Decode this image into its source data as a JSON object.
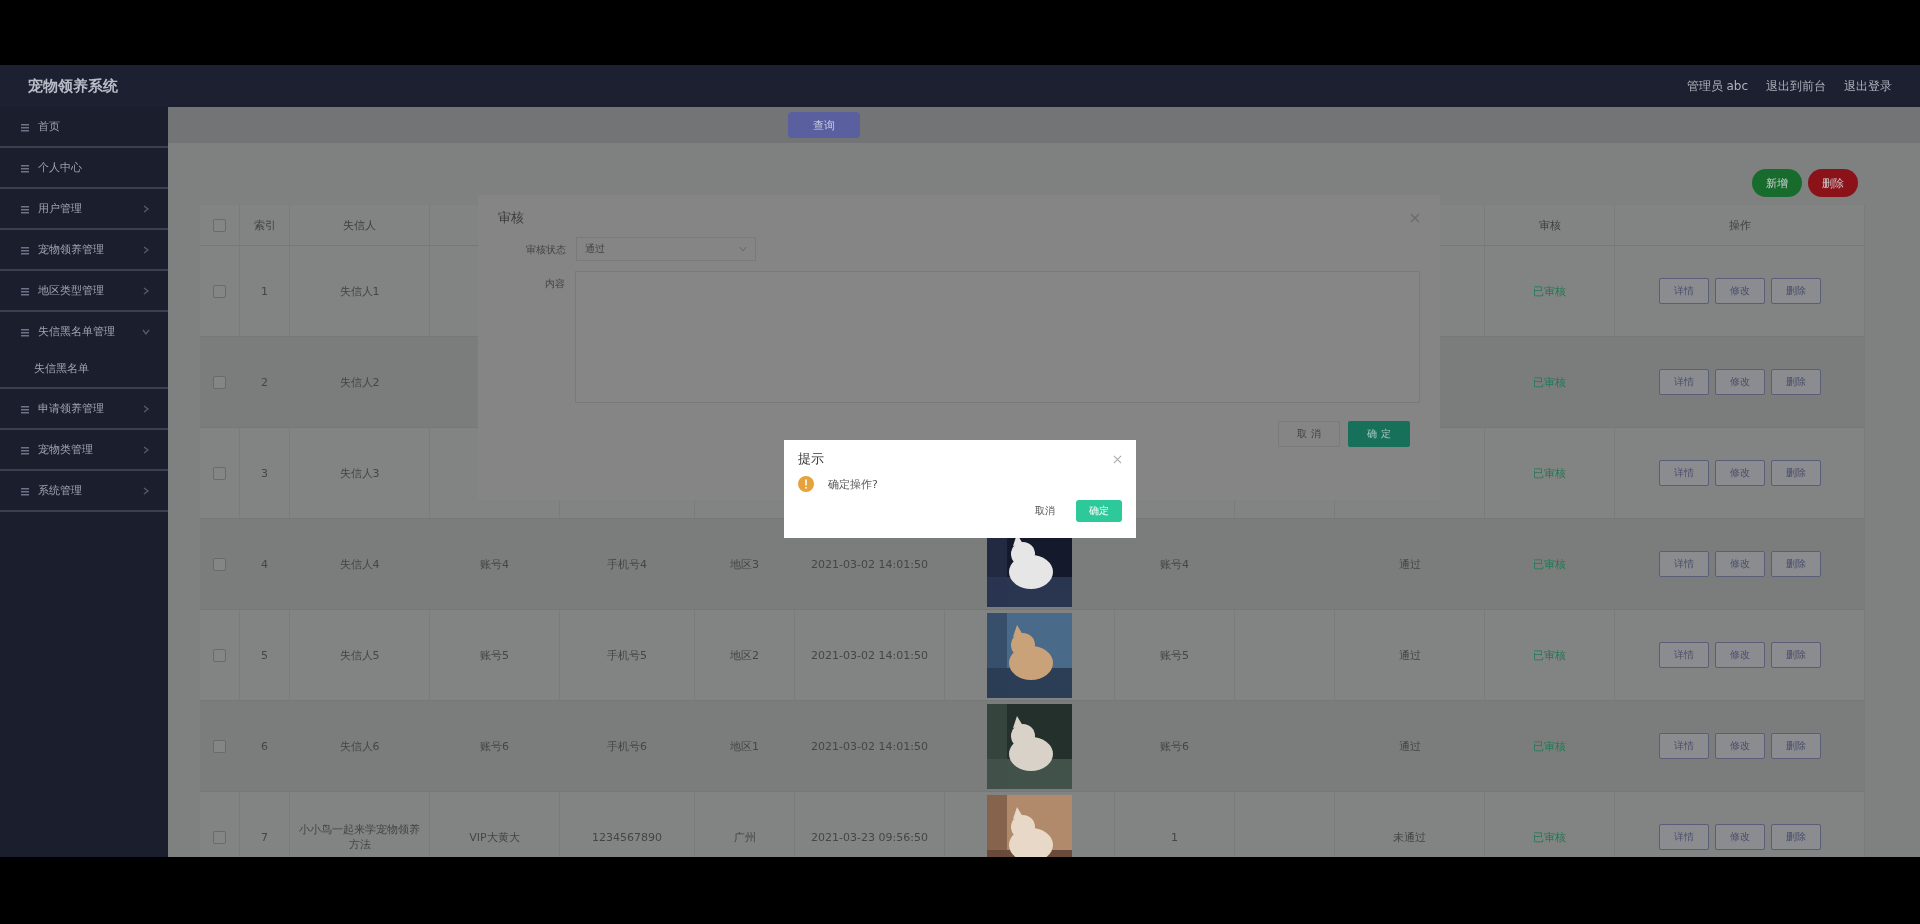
{
  "app": {
    "title": "宠物领养系统"
  },
  "header": {
    "user": "管理员 abc",
    "links": [
      "退出到前台",
      "退出登录"
    ]
  },
  "sidebar": {
    "items": [
      {
        "label": "首页",
        "kind": "plain"
      },
      {
        "label": "个人中心",
        "kind": "plain"
      },
      {
        "label": "用户管理",
        "kind": "menu",
        "expanded": false
      },
      {
        "label": "宠物领养管理",
        "kind": "menu",
        "expanded": false
      },
      {
        "label": "地区类型管理",
        "kind": "menu",
        "expanded": false
      },
      {
        "label": "失信黑名单管理",
        "kind": "menu",
        "expanded": true,
        "children": [
          {
            "label": "失信黑名单"
          }
        ]
      },
      {
        "label": "申请领养管理",
        "kind": "menu",
        "expanded": false
      },
      {
        "label": "宠物类管理",
        "kind": "menu",
        "expanded": false
      },
      {
        "label": "系统管理",
        "kind": "menu",
        "expanded": false
      }
    ]
  },
  "toolbar": {
    "search_button": "查询",
    "action_buttons": [
      {
        "label": "新增",
        "kind": "add"
      },
      {
        "label": "删除",
        "kind": "delete"
      }
    ]
  },
  "table": {
    "all_checked": false,
    "columns": [
      "索引",
      "失信人",
      "审核",
      "操作"
    ],
    "rows": [
      {
        "checked": false,
        "index": "1",
        "name": "失信人1",
        "status": "已审核",
        "actions": [
          "详情",
          "修改",
          "删除"
        ]
      },
      {
        "checked": false,
        "index": "2",
        "name": "失信人2",
        "status": "已审核",
        "actions": [
          "详情",
          "修改",
          "删除"
        ]
      },
      {
        "checked": false,
        "index": "3",
        "name": "失信人3",
        "status": "已审核",
        "actions": [
          "详情",
          "修改",
          "删除"
        ]
      },
      {
        "checked": false,
        "index": "4",
        "name": "失信人4",
        "field_3": "账号4",
        "field_4": "手机号4",
        "field_5": "地区3",
        "date": "2021-03-02 14:01:50",
        "photo": {
          "kind": "picture"
        },
        "field_7": "账号4",
        "review": "通过",
        "status": "已审核",
        "actions": [
          "详情",
          "修改",
          "删除"
        ]
      },
      {
        "checked": false,
        "index": "5",
        "name": "失信人5",
        "field_3": "账号5",
        "field_4": "手机号5",
        "field_5": "地区2",
        "date": "2021-03-02 14:01:50",
        "photo": {
          "kind": "picture"
        },
        "field_7": "账号5",
        "review": "通过",
        "status": "已审核",
        "actions": [
          "详情",
          "修改",
          "删除"
        ]
      },
      {
        "checked": false,
        "index": "6",
        "name": "失信人6",
        "field_3": "账号6",
        "field_4": "手机号6",
        "field_5": "地区1",
        "date": "2021-03-02 14:01:50",
        "photo": {
          "kind": "picture"
        },
        "field_7": "账号6",
        "review": "通过",
        "status": "已审核",
        "actions": [
          "详情",
          "修改",
          "删除"
        ]
      },
      {
        "checked": false,
        "index": "7",
        "name": "小小鸟一起来学宠物领养方法",
        "field_3": "VIP大黄大",
        "field_4": "1234567890",
        "field_5": "广州",
        "date": "2021-03-23 09:56:50",
        "photo": {
          "kind": "picture"
        },
        "field_7": "1",
        "review": "未通过",
        "status": "已审核",
        "actions": [
          "详情",
          "修改",
          "删除"
        ]
      }
    ]
  },
  "review_dialog": {
    "title": "审核",
    "status_label": "审核状态",
    "status_value": "通过",
    "content_label": "内容",
    "buttons": [
      "取 消",
      "确 定"
    ]
  },
  "confirm_dialog": {
    "title": "提示",
    "message": "确定操作?",
    "buttons": [
      "取消",
      "确定"
    ]
  }
}
